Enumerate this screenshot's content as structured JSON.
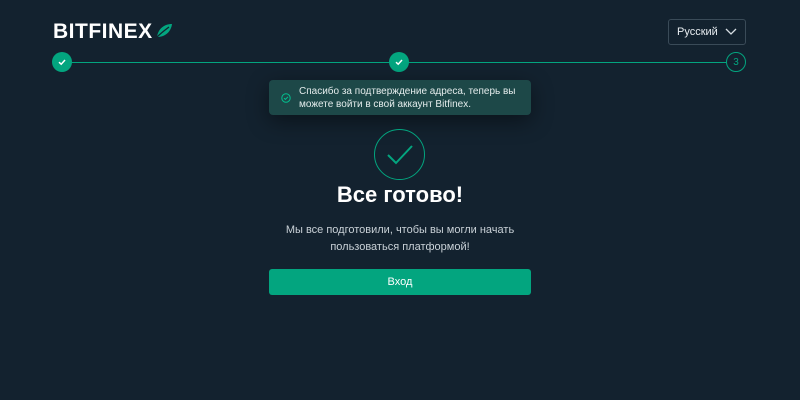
{
  "header": {
    "logo_text": "BITFINEX",
    "language_label": "Русский"
  },
  "stepper": {
    "steps": [
      {
        "state": "done"
      },
      {
        "state": "done"
      },
      {
        "state": "current",
        "label": "3"
      }
    ]
  },
  "toast": {
    "message": "Спасибо за подтверждение адреса, теперь вы можете войти в свой аккаунт Bitfinex."
  },
  "main": {
    "title": "Все готово!",
    "subtitle": "Мы все подготовили, чтобы вы могли начать пользоваться платформой!",
    "login_label": "Вход"
  },
  "colors": {
    "background": "#13222f",
    "accent": "#03a57f",
    "toast_bg": "#1d4848"
  },
  "icons": [
    "bitfinex-leaf-icon",
    "chevron-down-icon",
    "check-icon",
    "check-circle-icon"
  ]
}
